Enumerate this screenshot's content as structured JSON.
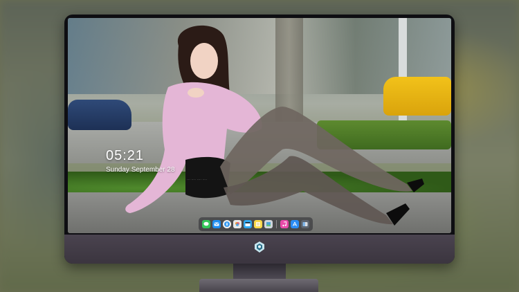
{
  "lockscreen": {
    "time": "05:21",
    "date": "Sunday September  28",
    "watermark": "··· ···· ···· ····"
  },
  "dock": {
    "apps": [
      {
        "name": "messages-icon",
        "color": "#34c759"
      },
      {
        "name": "mail-icon",
        "color": "#1f8ef1"
      },
      {
        "name": "safari-icon",
        "color": "#f2f2f2"
      },
      {
        "name": "photos-icon",
        "color": "#e8e8e8"
      },
      {
        "name": "clapper-icon",
        "color": "#2fa8f0"
      },
      {
        "name": "notes-icon",
        "color": "#f8d94a"
      },
      {
        "name": "preview-icon",
        "color": "#cfd6dc"
      },
      {
        "name": "music-icon",
        "color": "#e94aa8"
      },
      {
        "name": "app-store-icon",
        "color": "#2b8cf5"
      },
      {
        "name": "finder-icon",
        "color": "#5d6570"
      }
    ]
  },
  "colors": {
    "bezel": "#0e0e12",
    "chin": "#4a434f",
    "accent_taxi": "#f2c21a"
  }
}
